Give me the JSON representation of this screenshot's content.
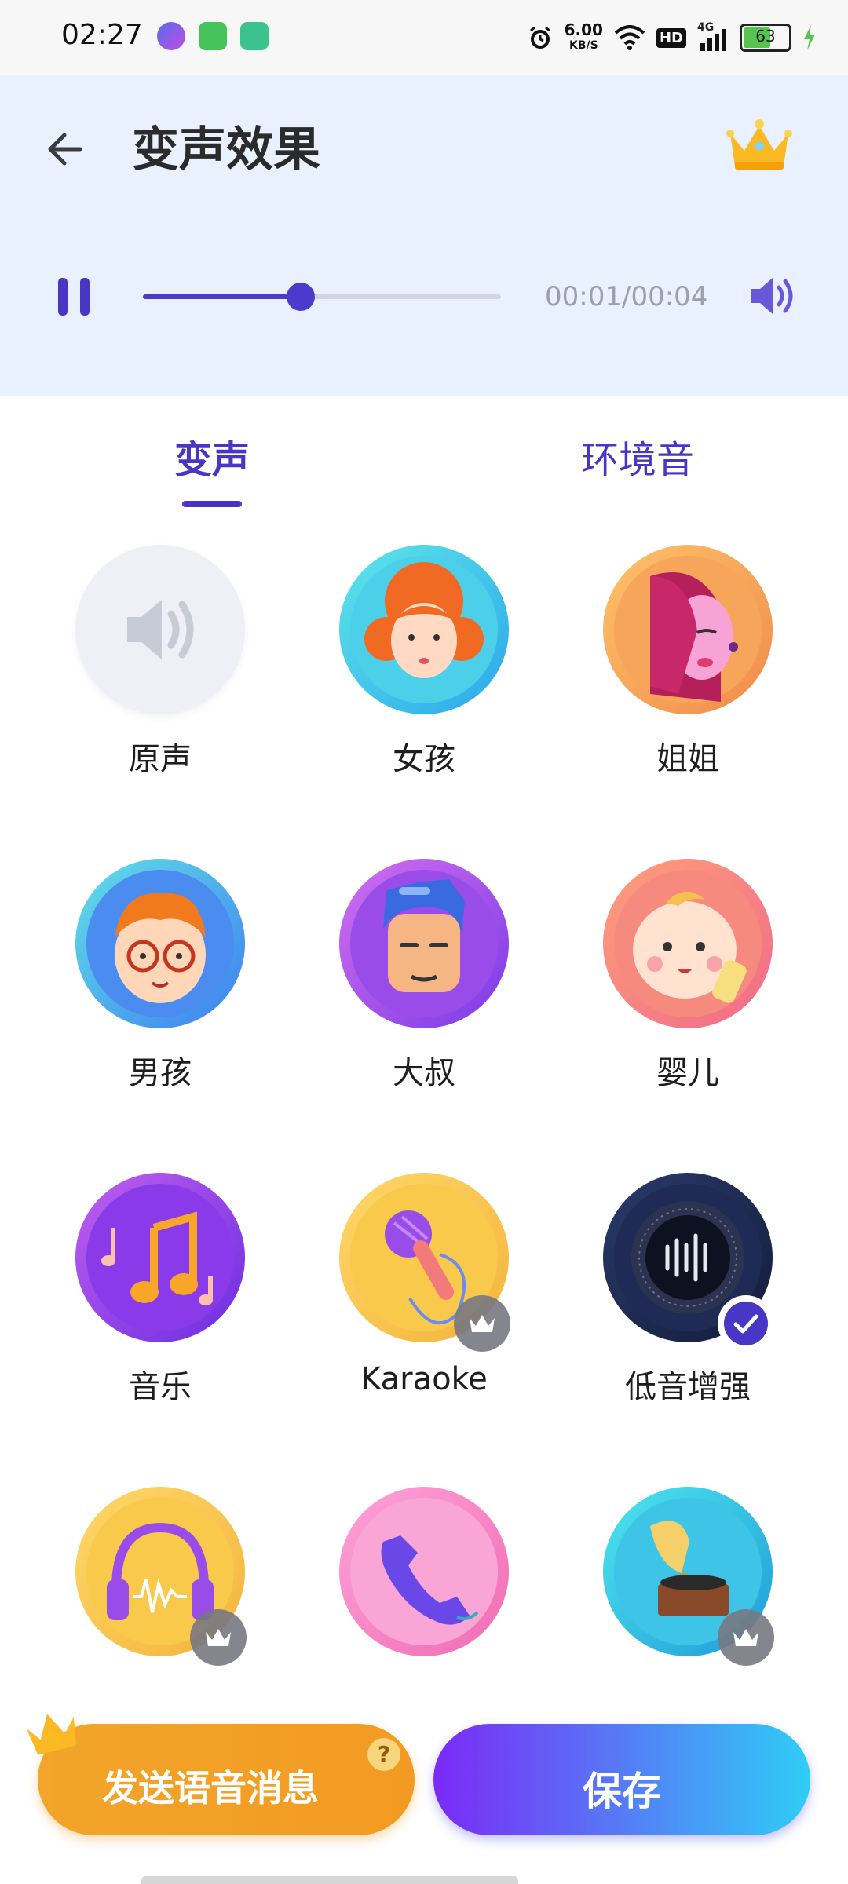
{
  "status_bar": {
    "time": "02:27",
    "net_speed_value": "6.00",
    "net_speed_unit": "KB/S",
    "network_type": "4G",
    "hd_label": "HD",
    "battery_level": "63"
  },
  "header": {
    "title": "变声效果",
    "back_icon": "arrow-left-icon",
    "vip_icon": "crown-icon"
  },
  "player": {
    "state": "playing",
    "current_time": "00:01",
    "total_time": "00:04",
    "time_display": "00:01/00:04",
    "progress_fraction": 0.44
  },
  "tabs": [
    {
      "label": "变声",
      "active": true
    },
    {
      "label": "环境音",
      "active": false
    }
  ],
  "effects": [
    {
      "label": "原声",
      "icon": "speaker-icon",
      "vip": false,
      "selected": false
    },
    {
      "label": "女孩",
      "icon": "girl-avatar-icon",
      "vip": false,
      "selected": false
    },
    {
      "label": "姐姐",
      "icon": "woman-avatar-icon",
      "vip": false,
      "selected": false
    },
    {
      "label": "男孩",
      "icon": "boy-avatar-icon",
      "vip": false,
      "selected": false
    },
    {
      "label": "大叔",
      "icon": "uncle-avatar-icon",
      "vip": false,
      "selected": false
    },
    {
      "label": "婴儿",
      "icon": "baby-avatar-icon",
      "vip": false,
      "selected": false
    },
    {
      "label": "音乐",
      "icon": "music-notes-icon",
      "vip": false,
      "selected": false
    },
    {
      "label": "Karaoke",
      "icon": "microphone-icon",
      "vip": true,
      "selected": false
    },
    {
      "label": "低音增强",
      "icon": "bass-knob-icon",
      "vip": false,
      "selected": true
    },
    {
      "label": "",
      "icon": "headphones-icon",
      "vip": true,
      "selected": false
    },
    {
      "label": "",
      "icon": "telephone-icon",
      "vip": false,
      "selected": false
    },
    {
      "label": "",
      "icon": "gramophone-icon",
      "vip": true,
      "selected": false
    }
  ],
  "actions": {
    "send_label": "发送语音消息",
    "save_label": "保存",
    "help_symbol": "?"
  },
  "colors": {
    "accent": "#4a36c4",
    "header_bg": "#e9f0fe",
    "send_button": "#f2a52a",
    "save_gradient_start": "#7b2af6",
    "save_gradient_end": "#2fcdf6"
  }
}
